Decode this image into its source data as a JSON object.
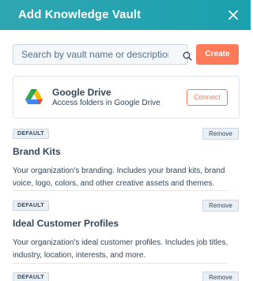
{
  "header": {
    "title": "Add Knowledge Vault",
    "close_icon": "close-icon",
    "color": "#1ba0ae"
  },
  "search": {
    "placeholder": "Search by vault name or description",
    "value": "",
    "icon": "search-icon"
  },
  "create_button": {
    "label": "Create",
    "color": "#ff7a59"
  },
  "google_drive": {
    "name": "Google Drive",
    "description": "Access folders in Google Drive",
    "connect_label": "Connect",
    "icon": "google-drive-logo"
  },
  "vaults": [
    {
      "badge": "DEFAULT",
      "remove_label": "Remove",
      "title": "Brand Kits",
      "description": "Your organization's branding. Includes your brand kits, brand voice, logo, colors, and other creative assets and themes."
    },
    {
      "badge": "DEFAULT",
      "remove_label": "Remove",
      "title": "Ideal Customer Profiles",
      "description": "Your organization's ideal customer profiles. Includes job titles, industry, location, interests, and more."
    },
    {
      "badge": "DEFAULT",
      "remove_label": "Remove"
    }
  ]
}
